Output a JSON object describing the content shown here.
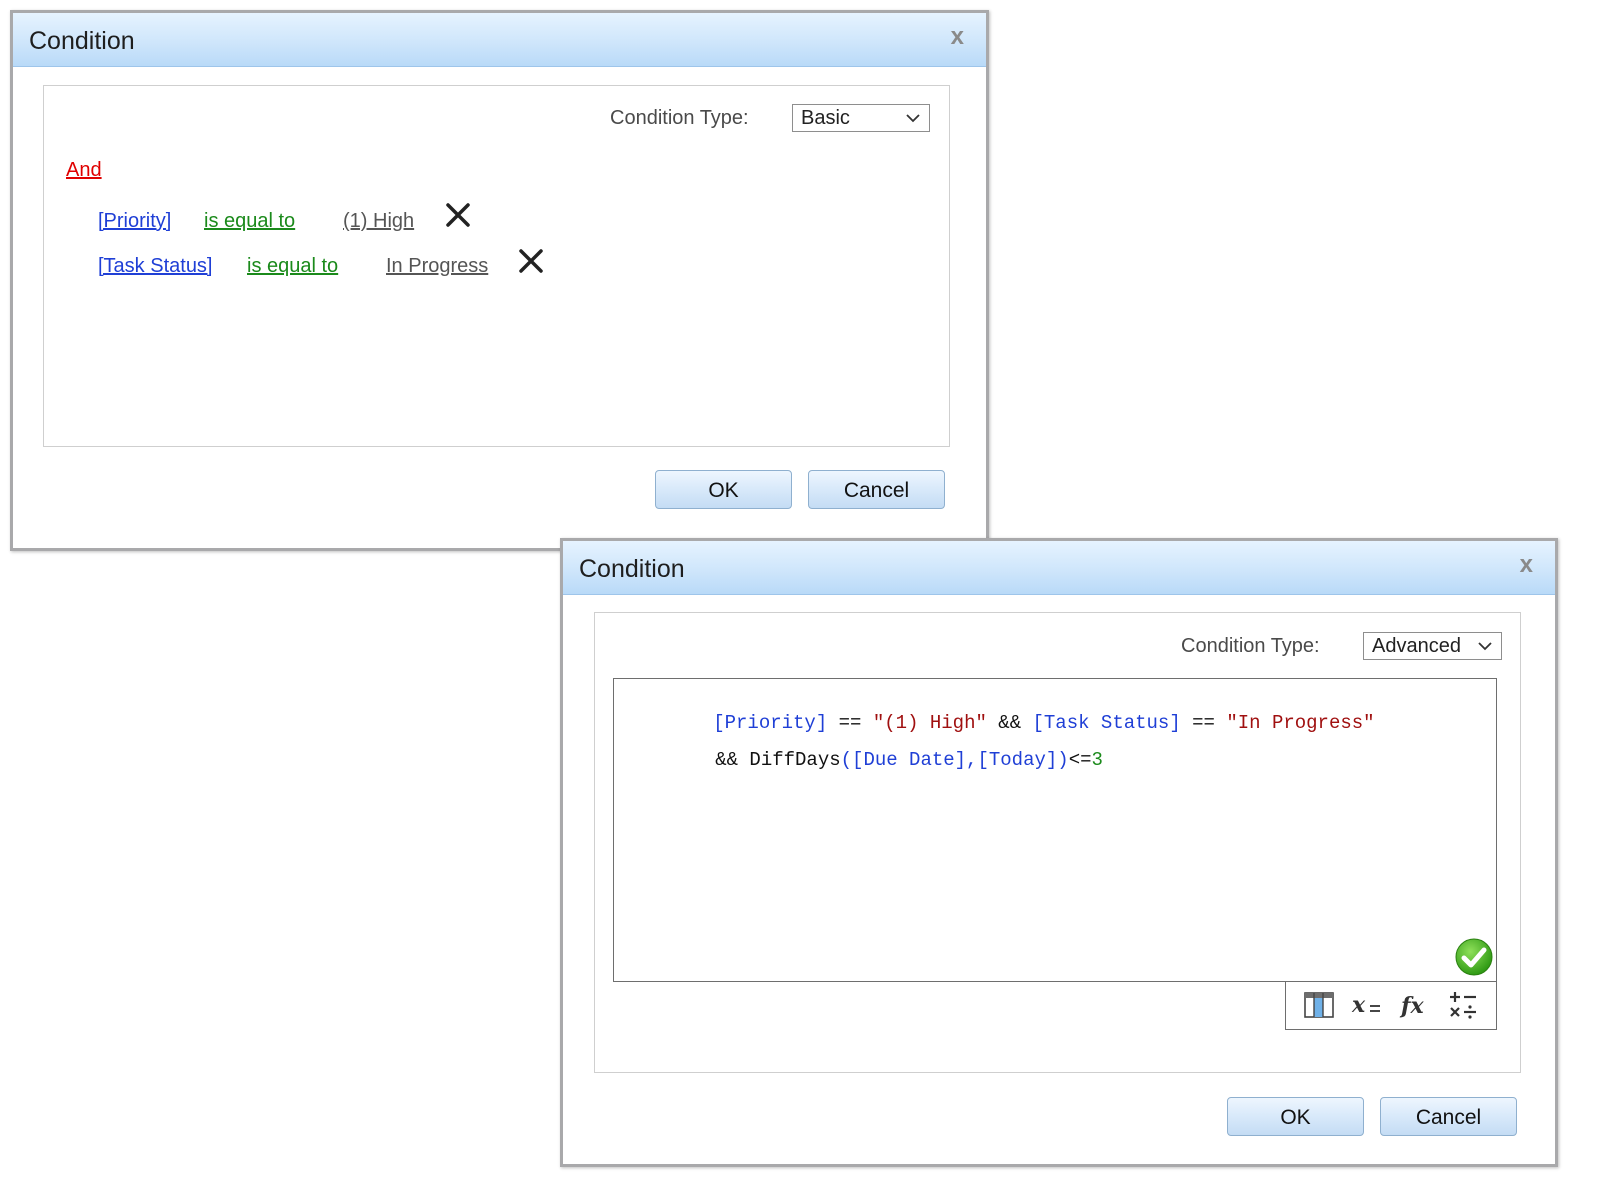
{
  "dialog_basic": {
    "title": "Condition",
    "close": "x",
    "condition_type_label": "Condition Type:",
    "condition_type_value": "Basic",
    "logic_operator": "And",
    "rules": [
      {
        "field": "[Priority]",
        "operator": "is equal to",
        "value": "(1) High"
      },
      {
        "field": "[Task Status]",
        "operator": "is equal to",
        "value": "In Progress"
      }
    ],
    "ok_label": "OK",
    "cancel_label": "Cancel"
  },
  "dialog_advanced": {
    "title": "Condition",
    "close": "x",
    "condition_type_label": "Condition Type:",
    "condition_type_value": "Advanced",
    "expression": {
      "line1": {
        "t1": "[Priority]",
        "t2": " == ",
        "t3": "\"(1) High\"",
        "t4": " && ",
        "t5": "[Task Status]",
        "t6": " == ",
        "t7": "\"In Progress\""
      },
      "line2": {
        "t1": "&& DiffDays",
        "t2": "([Due Date],[Today])",
        "t3": "<=",
        "t4": "3"
      }
    },
    "ok_label": "OK",
    "cancel_label": "Cancel"
  },
  "colors": {
    "field": "#1f3fd6",
    "operator": "#1b8a1b",
    "logic": "#e00000",
    "string": "#a01010",
    "valid": "#3aaa1e"
  },
  "icons": [
    "close-icon",
    "chevron-down-icon",
    "delete-icon",
    "valid-check-icon",
    "insert-column-icon",
    "insert-variable-icon",
    "insert-function-icon",
    "insert-operator-icon"
  ]
}
